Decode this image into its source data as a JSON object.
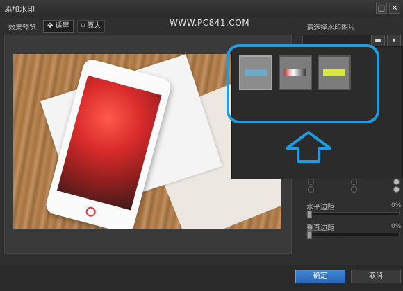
{
  "window": {
    "title": "添加水印",
    "maximize_icon": "□",
    "close_icon": "✕"
  },
  "overlay_text": "WWW.PC841.COM",
  "preview": {
    "label": "效果预览",
    "fit_label": "适屏",
    "original_label": "原大"
  },
  "sidebar": {
    "select_label": "请选择水印图片",
    "folder_icon": "folder-icon",
    "dropdown_icon": "chevron-down-icon",
    "horizontal_margin_label": "水平边距",
    "horizontal_margin_value": "0%",
    "vertical_margin_label": "垂直边距",
    "vertical_margin_value": "0%"
  },
  "thumbnails": [
    {
      "name": "watermark-thumb-1",
      "selected": true
    },
    {
      "name": "watermark-thumb-2",
      "selected": false
    },
    {
      "name": "watermark-thumb-3",
      "selected": false
    }
  ],
  "footer": {
    "ok_label": "确定",
    "cancel_label": "取消"
  },
  "colors": {
    "accent_blue": "#1e9de0",
    "ok_button": "#3f87d8"
  }
}
